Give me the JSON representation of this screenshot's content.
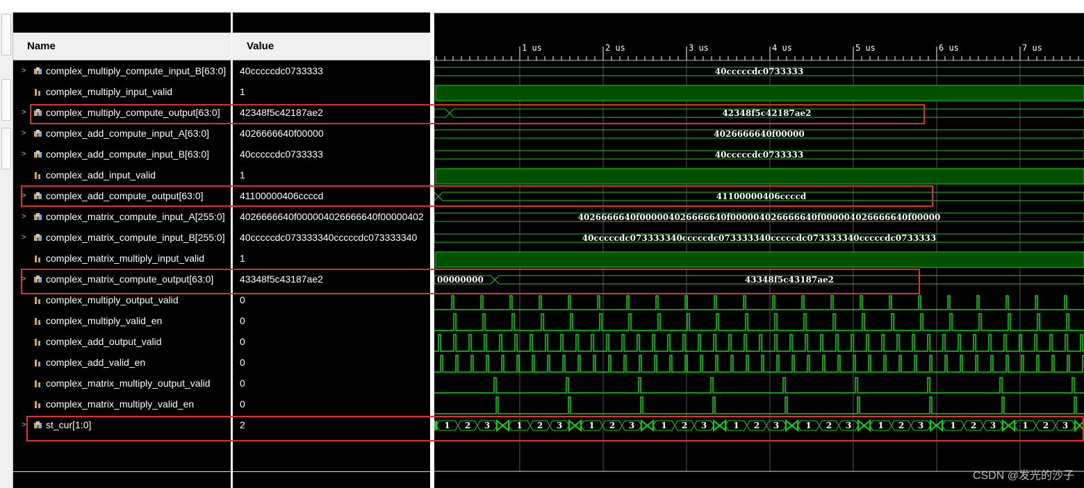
{
  "headers": {
    "name": "Name",
    "value": "Value"
  },
  "time_ruler": {
    "ticks": [
      "1 us",
      "2 us",
      "3 us",
      "4 us",
      "5 us",
      "6 us",
      "7 us"
    ]
  },
  "signals": [
    {
      "name": "complex_multiply_compute_input_B[63:0]",
      "value": "40cccccdc0733333",
      "type": "bus",
      "expandable": true,
      "wave_label": "40cccccdc0733333"
    },
    {
      "name": "complex_multiply_input_valid",
      "value": "1",
      "type": "bit-high"
    },
    {
      "name": "complex_multiply_compute_output[63:0]",
      "value": "42348f5c42187ae2",
      "type": "bus",
      "expandable": true,
      "wave_label": "42348f5c42187ae2"
    },
    {
      "name": "complex_add_compute_input_A[63:0]",
      "value": "4026666640f00000",
      "type": "bus",
      "expandable": true,
      "wave_label": "4026666640f00000"
    },
    {
      "name": "complex_add_compute_input_B[63:0]",
      "value": "40cccccdc0733333",
      "type": "bus",
      "expandable": true,
      "wave_label": "40cccccdc0733333"
    },
    {
      "name": "complex_add_input_valid",
      "value": "1",
      "type": "bit-high"
    },
    {
      "name": "complex_add_compute_output[63:0]",
      "value": "41100000406ccccd",
      "type": "bus",
      "expandable": true,
      "wave_label": "41100000406ccccd"
    },
    {
      "name": "complex_matrix_compute_input_A[255:0]",
      "value": "4026666640f000004026666640f00000402",
      "type": "bus",
      "expandable": true,
      "wave_label": "4026666640f000004026666640f000004026666640f000004026666640f00000"
    },
    {
      "name": "complex_matrix_compute_input_B[255:0]",
      "value": "40cccccdc073333340cccccdc073333340",
      "type": "bus",
      "expandable": true,
      "wave_label": "40cccccdc073333340cccccdc073333340cccccdc073333340cccccdc0733333"
    },
    {
      "name": "complex_matrix_multiply_input_valid",
      "value": "1",
      "type": "bit-high"
    },
    {
      "name": "complex_matrix_compute_output[63:0]",
      "value": "43348f5c43187ae2",
      "type": "bus",
      "expandable": true,
      "wave_label_initial": "00000000",
      "wave_label": "43348f5c43187ae2"
    },
    {
      "name": "complex_multiply_output_valid",
      "value": "0",
      "type": "pulse-tall"
    },
    {
      "name": "complex_multiply_valid_en",
      "value": "0",
      "type": "pulse-mid"
    },
    {
      "name": "complex_add_output_valid",
      "value": "0",
      "type": "pulse-dense"
    },
    {
      "name": "complex_add_valid_en",
      "value": "0",
      "type": "pulse-dense2"
    },
    {
      "name": "complex_matrix_multiply_output_valid",
      "value": "0",
      "type": "pulse-sparse"
    },
    {
      "name": "complex_matrix_multiply_valid_en",
      "value": "0",
      "type": "pulse-sparse2"
    },
    {
      "name": "st_cur[1:0]",
      "value": "2",
      "type": "state",
      "expandable": true,
      "state_labels": [
        "1",
        "2",
        "3"
      ]
    }
  ],
  "watermark": "CSDN @发光的沙子",
  "colors": {
    "wave_green": "#00e000",
    "bus_line": "#22c922",
    "high_fill": "#005000",
    "highlight_red": "#e03030"
  }
}
